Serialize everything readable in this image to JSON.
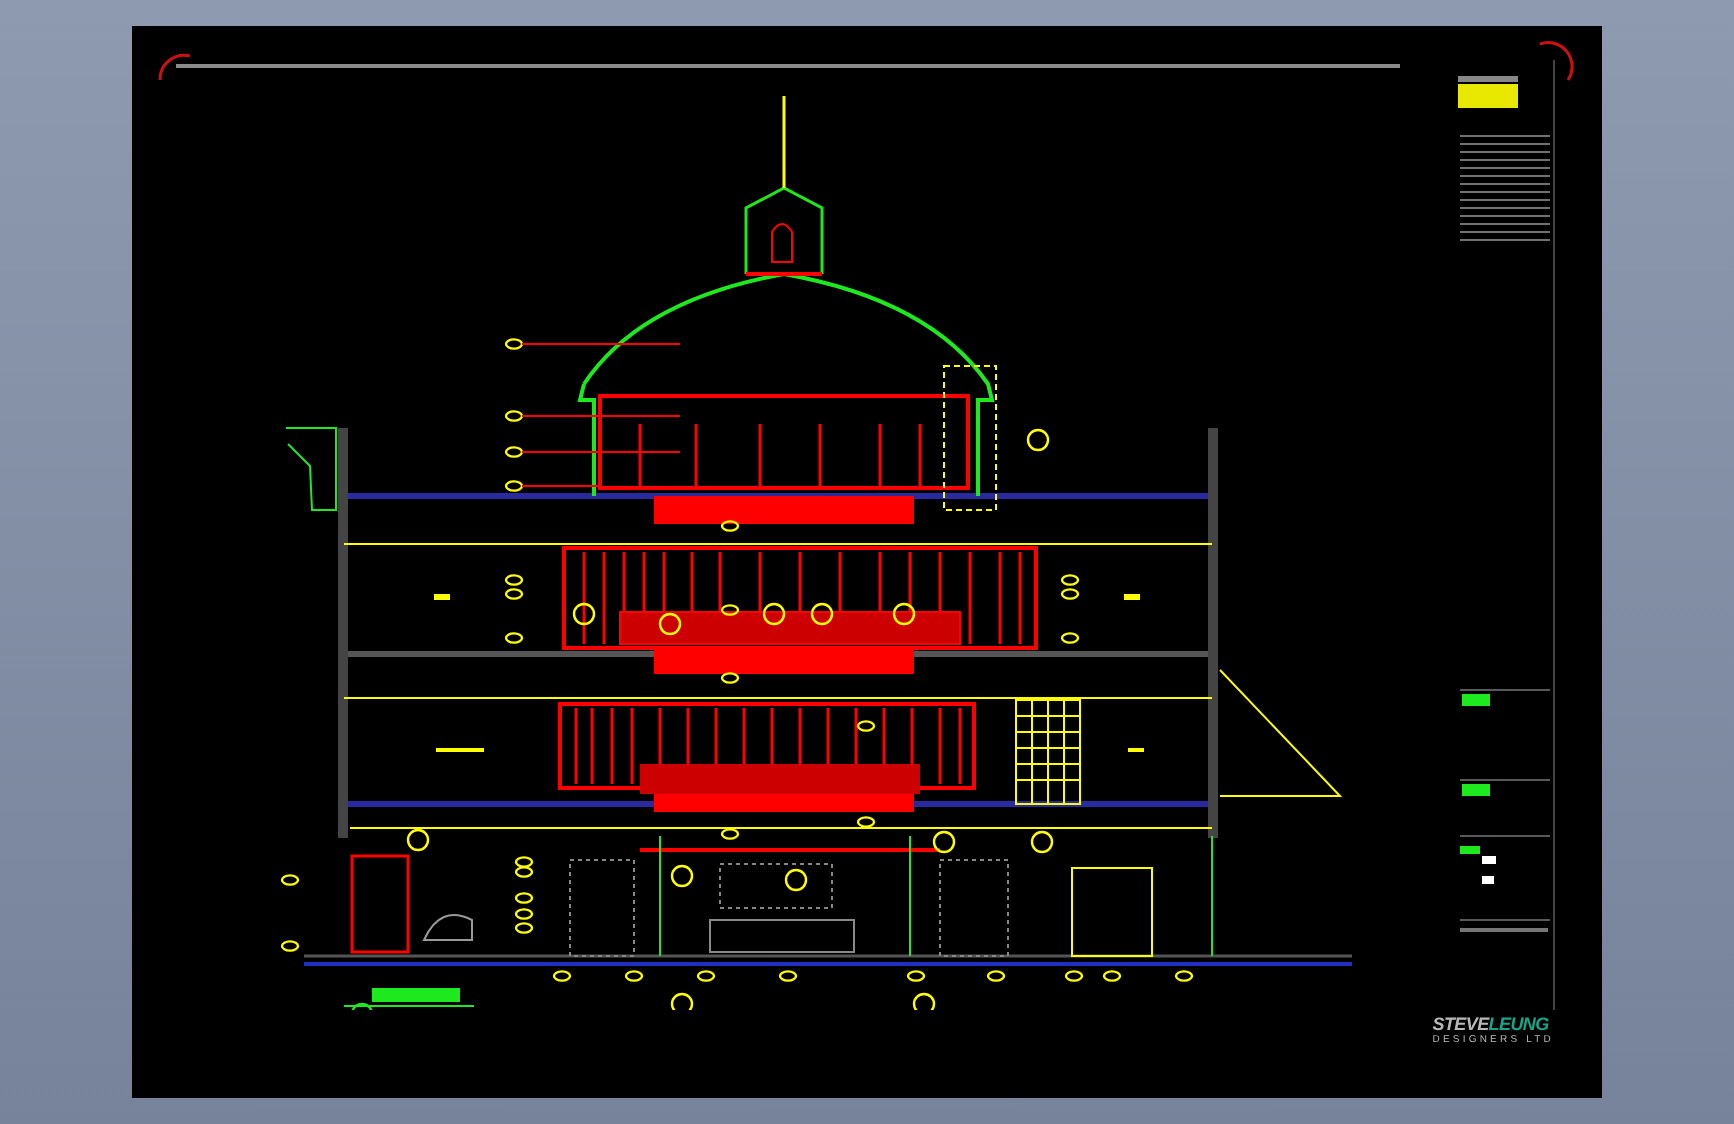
{
  "sheet": {
    "logo": {
      "name_first": "STEVE",
      "name_second": "LEUNG",
      "subtitle": "DESIGNERS LTD"
    }
  }
}
